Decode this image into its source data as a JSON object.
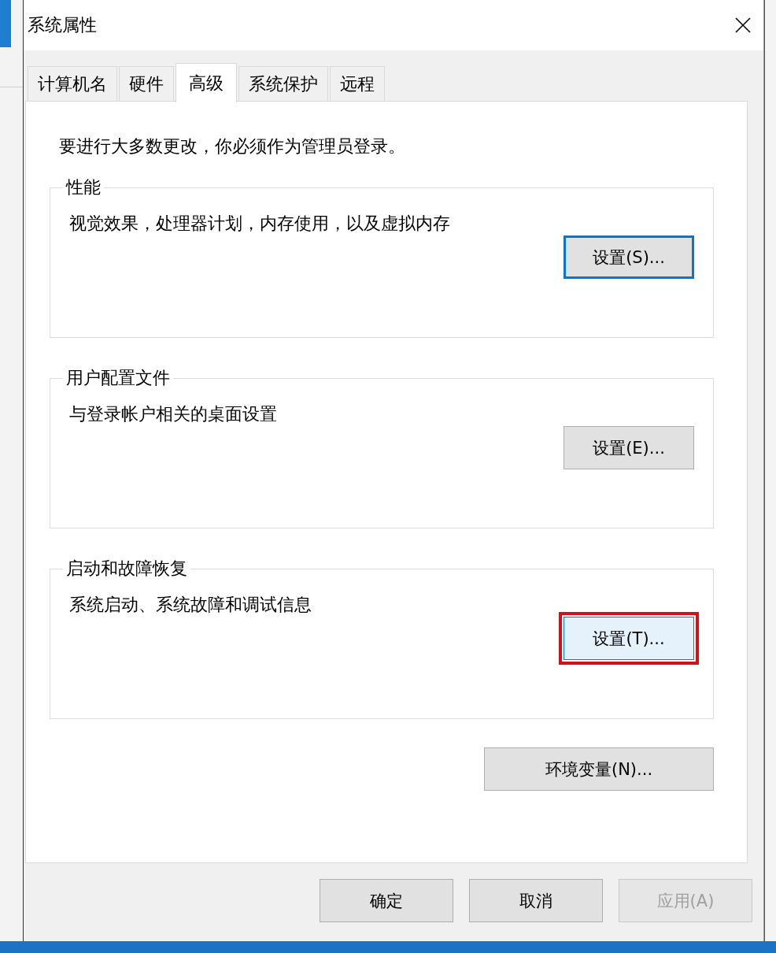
{
  "window": {
    "title": "系统属性"
  },
  "tabs": [
    {
      "label": "计算机名",
      "selected": false
    },
    {
      "label": "硬件",
      "selected": false
    },
    {
      "label": "高级",
      "selected": true
    },
    {
      "label": "系统保护",
      "selected": false
    },
    {
      "label": "远程",
      "selected": false
    }
  ],
  "notice": "要进行大多数更改，你必须作为管理员登录。",
  "groups": [
    {
      "title": "性能",
      "description": "视觉效果，处理器计划，内存使用，以及虚拟内存",
      "button": {
        "label": "设置(S)...",
        "focused": true,
        "highlighted": false
      }
    },
    {
      "title": "用户配置文件",
      "description": "与登录帐户相关的桌面设置",
      "button": {
        "label": "设置(E)...",
        "focused": false,
        "highlighted": false
      }
    },
    {
      "title": "启动和故障恢复",
      "description": "系统启动、系统故障和调试信息",
      "button": {
        "label": "设置(T)...",
        "focused": false,
        "highlighted": true
      }
    }
  ],
  "env_button": {
    "label": "环境变量(N)..."
  },
  "footer_buttons": [
    {
      "label": "确定",
      "disabled": false
    },
    {
      "label": "取消",
      "disabled": false
    },
    {
      "label": "应用(A)",
      "disabled": true
    }
  ]
}
